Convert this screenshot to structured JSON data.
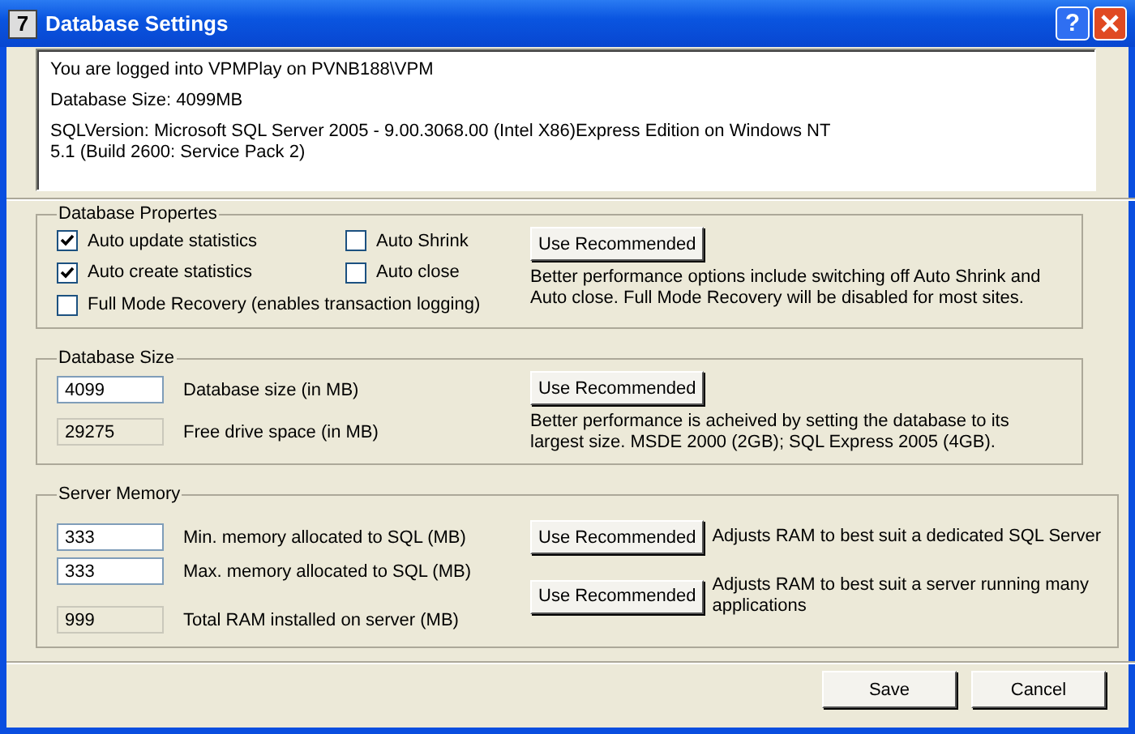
{
  "window": {
    "title": "Database Settings",
    "icon_text": "7",
    "help": "?"
  },
  "info": [
    {
      "lines": [
        "You are logged into VPMPlay on PVNB188\\VPM"
      ]
    },
    {
      "lines": [
        "Database Size: 4099MB"
      ]
    },
    {
      "lines": [
        "SQLVersion: Microsoft SQL Server 2005 - 9.00.3068.00 (Intel X86)Express Edition on Windows NT",
        "5.1 (Build 2600: Service Pack 2)"
      ]
    }
  ],
  "properties": {
    "title": "Database Propertes",
    "options": [
      {
        "label": "Auto update statistics",
        "checked": true
      },
      {
        "label": "Auto Shrink",
        "checked": false
      },
      {
        "label": "Auto create statistics",
        "checked": true
      },
      {
        "label": "Auto close",
        "checked": false
      },
      {
        "label": "Full Mode Recovery (enables transaction logging)",
        "checked": false
      }
    ],
    "button": "Use Recommended",
    "note": "Better performance options include switching off Auto Shrink and Auto close. Full Mode Recovery will be disabled for most sites."
  },
  "size": {
    "title": "Database Size",
    "fields": [
      {
        "value": "4099",
        "label": "Database size (in MB)",
        "disabled": false
      },
      {
        "value": "29275",
        "label": "Free drive space (in MB)",
        "disabled": true
      }
    ],
    "button": "Use Recommended",
    "note": "Better performance is acheived by setting the database to its largest size. MSDE 2000 (2GB); SQL Express 2005 (4GB)."
  },
  "memory": {
    "title": "Server Memory",
    "fields": [
      {
        "value": "333",
        "label": "Min. memory allocated to SQL (MB)",
        "disabled": false
      },
      {
        "value": "333",
        "label": "Max. memory allocated to SQL (MB)",
        "disabled": false
      },
      {
        "value": "999",
        "label": "Total RAM installed on server (MB)",
        "disabled": true
      }
    ],
    "actions": [
      {
        "button": "Use Recommended",
        "note": "Adjusts RAM to best suit a dedicated SQL Server"
      },
      {
        "button": "Use Recommended",
        "note": "Adjusts RAM to best suit a server running many applications"
      }
    ]
  },
  "buttons": [
    "Save",
    "Cancel"
  ]
}
